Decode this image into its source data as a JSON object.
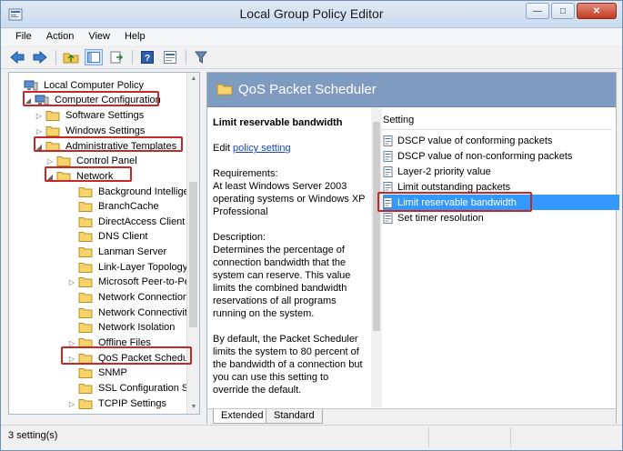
{
  "window": {
    "title": "Local Group Policy Editor"
  },
  "menu": [
    "File",
    "Action",
    "View",
    "Help"
  ],
  "toolbar": {
    "icons": [
      "back-icon",
      "forward-icon",
      "up-folder-icon",
      "show-hide-tree-icon",
      "export-list-icon",
      "help-icon",
      "properties-icon",
      "filter-icon"
    ]
  },
  "tree": {
    "items": [
      {
        "label": "Local Computer Policy"
      },
      {
        "label": "Computer Configuration"
      },
      {
        "label": "Software Settings"
      },
      {
        "label": "Windows Settings"
      },
      {
        "label": "Administrative Templates"
      },
      {
        "label": "Control Panel"
      },
      {
        "label": "Network"
      },
      {
        "label": "Background Intelligen"
      },
      {
        "label": "BranchCache"
      },
      {
        "label": "DirectAccess Client Ex"
      },
      {
        "label": "DNS Client"
      },
      {
        "label": "Lanman Server"
      },
      {
        "label": "Link-Layer Topology D"
      },
      {
        "label": "Microsoft Peer-to-Pee"
      },
      {
        "label": "Network Connections"
      },
      {
        "label": "Network Connectivity"
      },
      {
        "label": "Network Isolation"
      },
      {
        "label": "Offline Files"
      },
      {
        "label": "QoS Packet Scheduler"
      },
      {
        "label": "SNMP"
      },
      {
        "label": "SSL Configuration Sett"
      },
      {
        "label": "TCPIP Settings"
      }
    ]
  },
  "header": {
    "title": "QoS Packet Scheduler"
  },
  "description": {
    "title": "Limit reservable bandwidth",
    "edit_prefix": "Edit",
    "edit_link": "policy setting",
    "requirements": "Requirements:\nAt least Windows Server 2003 operating systems or Windows XP Professional",
    "desc": "Description:\nDetermines the percentage of connection bandwidth that the system can reserve. This value limits the combined bandwidth reservations of all programs running on the system.",
    "default": "By default, the Packet Scheduler limits the system to 80 percent of the bandwidth of a connection but you can use this setting to override the default."
  },
  "settings": {
    "column_header": "Setting",
    "items": [
      {
        "label": "DSCP value of conforming packets"
      },
      {
        "label": "DSCP value of non-conforming packets"
      },
      {
        "label": "Layer-2 priority value"
      },
      {
        "label": "Limit outstanding packets"
      },
      {
        "label": "Limit reservable bandwidth"
      },
      {
        "label": "Set timer resolution"
      }
    ]
  },
  "tabs": {
    "extended": "Extended",
    "standard": "Standard"
  },
  "status": {
    "text": "3 setting(s)"
  },
  "colors": {
    "accent": "#3399ff",
    "header_band": "#7f9cc0",
    "highlight_border": "#c62828"
  }
}
